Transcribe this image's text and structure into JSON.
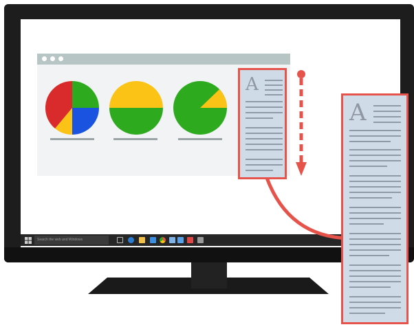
{
  "taskbar": {
    "search_placeholder": "Search the web and Windows",
    "icons": [
      "task-view-icon",
      "edge-icon",
      "explorer-icon",
      "store-icon",
      "chrome-icon",
      "app-icon",
      "app-icon",
      "app-icon",
      "app-icon"
    ]
  },
  "document": {
    "glyph": "A"
  },
  "colors": {
    "red": "#e5534b",
    "green": "#2eaa1e",
    "yellow": "#fbc315",
    "blue": "#1a53e0",
    "doc_fill": "#d0dbe8",
    "bezel": "#1d1d1d"
  }
}
